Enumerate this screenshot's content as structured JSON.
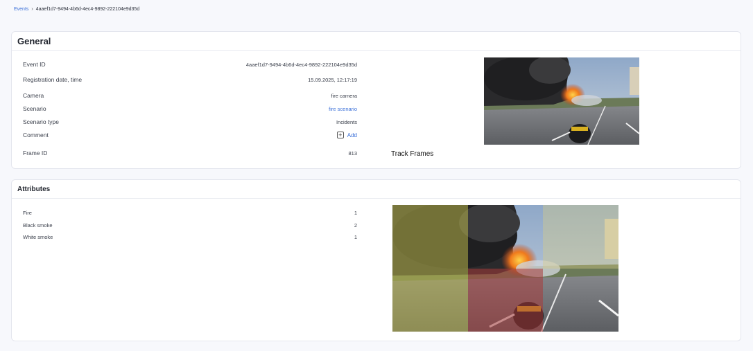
{
  "breadcrumb": {
    "root": "Events",
    "current": "4aaef1d7-9494-4b6d-4ec4-9892-222104e9d35d"
  },
  "general": {
    "title": "General",
    "rows": {
      "event_id": {
        "label": "Event ID",
        "value": "4aaef1d7-9494-4b6d-4ec4-9892-222104e9d35d"
      },
      "registration": {
        "label": "Registration date, time",
        "value": "15.09.2025, 12:17:19"
      },
      "camera": {
        "label": "Camera",
        "value": "fire camera"
      },
      "scenario": {
        "label": "Scenario",
        "value": "fire scenario"
      },
      "scenario_type": {
        "label": "Scenario type",
        "value": "Incidents"
      },
      "comment": {
        "label": "Comment",
        "add_label": "Add"
      },
      "frame_id": {
        "label": "Frame ID",
        "value": "813"
      }
    },
    "track_frames_label": "Track Frames"
  },
  "attributes": {
    "title": "Attributes",
    "items": [
      {
        "label": "Fire",
        "value": "1"
      },
      {
        "label": "Black smoke",
        "value": "2"
      },
      {
        "label": "White smoke",
        "value": "1"
      }
    ]
  },
  "colors": {
    "link": "#3a6fd8",
    "fire_mask": "#a83a3a",
    "smoke_mask": "#b8b44a"
  }
}
